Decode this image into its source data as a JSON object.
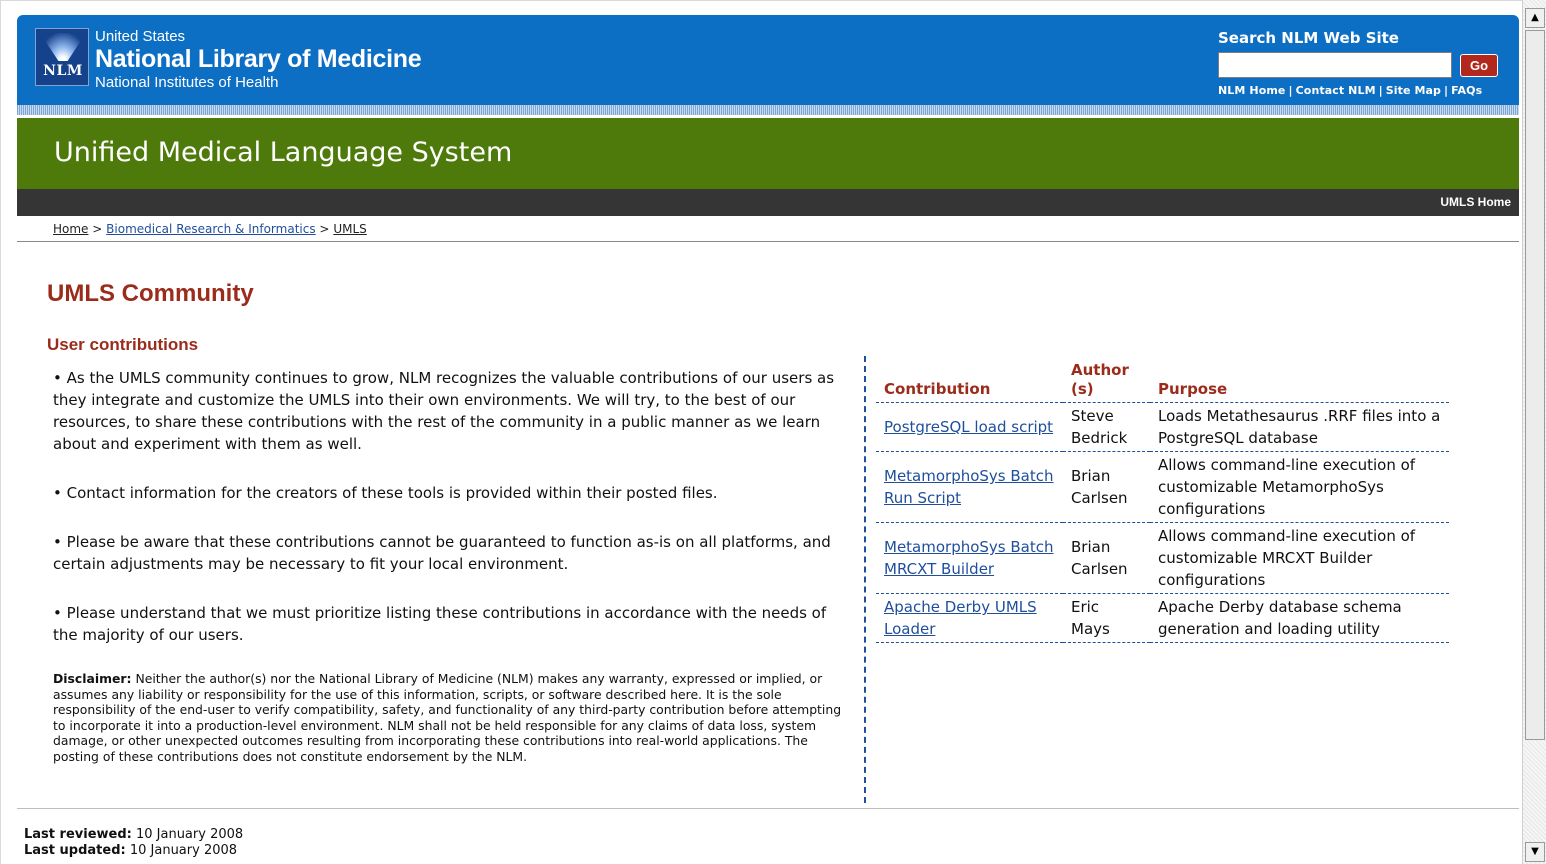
{
  "header": {
    "logo_text": "NLM",
    "org_line1": "United States",
    "org_line2": "National Library of Medicine",
    "org_line3": "National Institutes of Health",
    "search_title": "Search NLM Web Site",
    "search_value": "",
    "go_label": "Go",
    "links": [
      "NLM Home",
      "Contact NLM",
      "Site Map",
      "FAQs"
    ],
    "banner_title": "Unified Medical Language System",
    "nav_link": "UMLS Home"
  },
  "breadcrumb": {
    "items": [
      "Home",
      "Biomedical Research & Informatics",
      "UMLS"
    ],
    "separator": ">"
  },
  "main": {
    "page_title": "UMLS Community",
    "section_title": "User contributions",
    "paragraphs": [
      "• As the UMLS community continues to grow, NLM recognizes the valuable contributions of our users as they integrate and customize the UMLS into their own environments. We will try, to the best of our resources, to share these contributions with the rest of the community in a public manner as we learn about and experiment with them as well.",
      "• Contact information for the creators of these tools is provided within their posted files.",
      "• Please be aware that these contributions cannot be guaranteed to function as-is on all platforms, and certain adjustments may be necessary to fit your local environment.",
      "• Please understand that we must prioritize listing these contributions in accordance with the needs of the majority of our users."
    ],
    "disclaimer_label": "Disclaimer:",
    "disclaimer_text": " Neither the author(s) nor the National Library of Medicine (NLM) makes any warranty, expressed or implied, or assumes any liability or responsibility for the use of this information, scripts, or software described here. It is the sole responsibility of the end-user to verify compatibility, safety, and functionality of any third-party contribution before attempting to incorporate it into a production-level environment. NLM shall not be held responsible for any claims of data loss, system damage, or other unexpected outcomes resulting from incorporating these contributions into real-world applications. The posting of these contributions does not constitute endorsement by the NLM."
  },
  "contributions": {
    "headers": [
      "Contribution",
      "Author (s)",
      "Purpose"
    ],
    "rows": [
      {
        "name": "PostgreSQL load script",
        "author": "Steve Bedrick",
        "purpose": "Loads Metathesaurus .RRF files into a PostgreSQL database"
      },
      {
        "name": "MetamorphoSys Batch Run Script",
        "author": "Brian Carlsen",
        "purpose": "Allows command-line execution of customizable MetamorphoSys configurations"
      },
      {
        "name": "MetamorphoSys Batch MRCXT Builder",
        "author": "Brian Carlsen",
        "purpose": "Allows command-line execution of customizable MRCXT Builder configurations"
      },
      {
        "name": "Apache Derby UMLS Loader",
        "author": "Eric Mays",
        "purpose": "Apache Derby database schema generation and loading utility"
      }
    ]
  },
  "footer": {
    "reviewed_label": "Last reviewed:",
    "reviewed_date": " 10 January 2008",
    "updated_label": "Last updated:",
    "updated_date": " 10 January 2008"
  },
  "colors": {
    "header_blue": "#0d6fc4",
    "banner_green": "#4e7a0b",
    "nav_dark": "#353535",
    "heading_red": "#9b2b1b",
    "link_blue": "#1f4f9c",
    "go_red": "#b3281d"
  }
}
